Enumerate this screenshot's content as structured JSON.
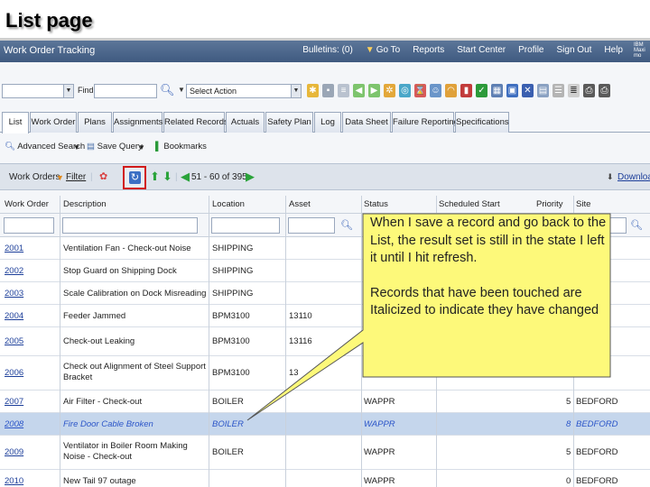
{
  "slide_title": "List page",
  "header": {
    "title": "Work Order Tracking",
    "links": [
      "Bulletins: (0)",
      "Go To",
      "Reports",
      "Start Center",
      "Profile",
      "Sign Out",
      "Help"
    ],
    "brand": "IBM Maximo"
  },
  "toolbar": {
    "find_label": "Find:",
    "select_action": "Select Action"
  },
  "tabs": [
    "List",
    "Work Order",
    "Plans",
    "Assignments",
    "Related Records",
    "Actuals",
    "Safety Plan",
    "Log",
    "Data Sheet",
    "Failure Reporting",
    "Specifications"
  ],
  "query": {
    "advanced_search": "Advanced Search",
    "save_query": "Save Query",
    "bookmarks": "Bookmarks"
  },
  "table": {
    "title": "Work Orders",
    "filter_label": "Filter",
    "pagination": "51 - 60 of 395",
    "download": "Download",
    "columns": [
      "Work Order",
      "Description",
      "Location",
      "Asset",
      "Status",
      "Scheduled Start",
      "Priority",
      "Site"
    ],
    "rows": [
      {
        "wo": "2001",
        "desc": "Ventilation Fan - Check-out Noise",
        "loc": "SHIPPING",
        "asset": "",
        "status": "",
        "priority": "",
        "site": ""
      },
      {
        "wo": "2002",
        "desc": "Stop Guard on Shipping Dock",
        "loc": "SHIPPING",
        "asset": "",
        "status": "",
        "priority": "",
        "site": ""
      },
      {
        "wo": "2003",
        "desc": "Scale Calibration on Dock Misreading",
        "loc": "SHIPPING",
        "asset": "",
        "status": "",
        "priority": "",
        "site": ""
      },
      {
        "wo": "2004",
        "desc": "Feeder Jammed",
        "loc": "BPM3100",
        "asset": "13110",
        "status": "",
        "priority": "",
        "site": ""
      },
      {
        "wo": "2005",
        "desc": "Check-out Leaking",
        "loc": "BPM3100",
        "asset": "13116",
        "status": "",
        "priority": "",
        "site": ""
      },
      {
        "wo": "2006",
        "desc": "Check out Alignment of Steel Support Bracket",
        "loc": "BPM3100",
        "asset": "13",
        "status": "",
        "priority": "",
        "site": "FORD"
      },
      {
        "wo": "2007",
        "desc": "Air Filter - Check-out",
        "loc": "BOILER",
        "asset": "",
        "status": "WAPPR",
        "priority": "5",
        "site": "BEDFORD"
      },
      {
        "wo": "2008",
        "desc": "Fire Door Cable Broken",
        "loc": "BOILER",
        "asset": "",
        "status": "WAPPR",
        "priority": "8",
        "site": "BEDFORD"
      },
      {
        "wo": "2009",
        "desc": "Ventilator in Boiler Room Making Noise - Check-out",
        "loc": "BOILER",
        "asset": "",
        "status": "WAPPR",
        "priority": "5",
        "site": "BEDFORD"
      },
      {
        "wo": "2010",
        "desc": "New Tail 97 outage",
        "loc": "",
        "asset": "",
        "status": "WAPPR",
        "priority": "0",
        "site": "BEDFORD"
      }
    ]
  },
  "callout": {
    "paragraph_1": "When I save a record and go back to the List, the result set is still in the state I left it until I hit refresh.",
    "paragraph_2": "Records that have been touched are Italicized to indicate they have changed"
  },
  "colors": {
    "header_bg": "#4a6589",
    "callout_fill": "#fdf97a",
    "highlight_box": "#d11a1a",
    "selected_row": "#c5d6ec"
  }
}
